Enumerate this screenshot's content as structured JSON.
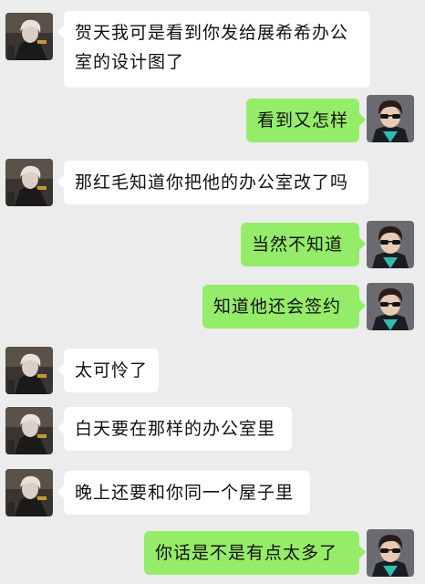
{
  "messages": [
    {
      "side": "left",
      "text": "贺天我可是看到你发给展希希办公室的设计图了"
    },
    {
      "side": "right",
      "text": "看到又怎样"
    },
    {
      "side": "left",
      "text": "那红毛知道你把他的办公室改了吗"
    },
    {
      "side": "right",
      "text": "当然不知道"
    },
    {
      "side": "right",
      "text": "知道他还会签约"
    },
    {
      "side": "left",
      "text": "太可怜了"
    },
    {
      "side": "left",
      "text": "白天要在那样的办公室里"
    },
    {
      "side": "left",
      "text": "晚上还要和你同一个屋子里"
    },
    {
      "side": "right",
      "text": "你话是不是有点太多了"
    }
  ],
  "icons": {
    "left_avatar": "gray-haired-character-avatar",
    "right_avatar": "dark-haired-character-with-sunglasses-avatar"
  },
  "colors": {
    "background": "#ececec",
    "incoming_bubble": "#ffffff",
    "outgoing_bubble": "#95ec69"
  }
}
